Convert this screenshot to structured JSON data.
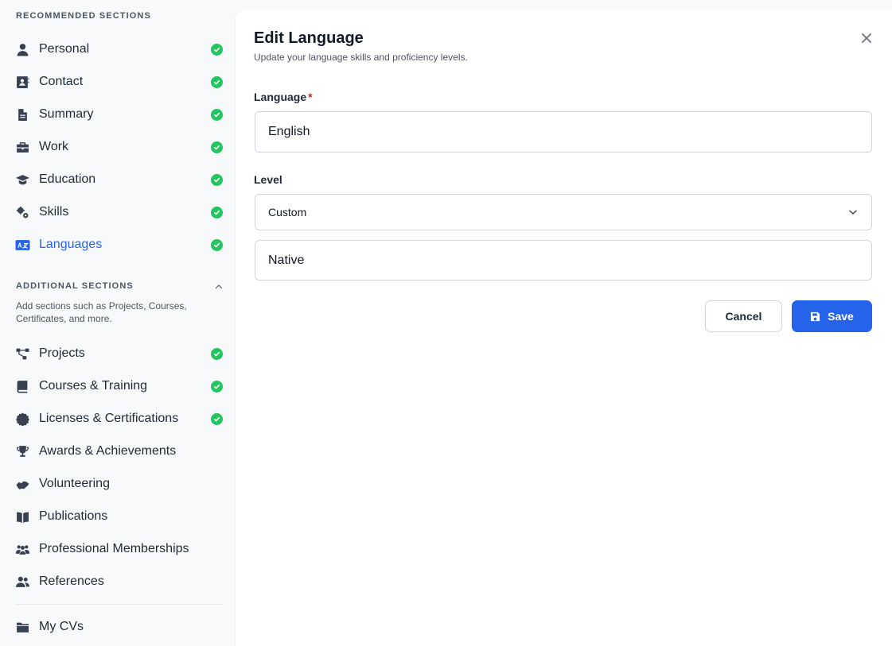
{
  "sidebar": {
    "recommended_heading": "RECOMMENDED SECTIONS",
    "recommended_items": [
      {
        "label": "Personal",
        "icon": "user-icon",
        "completed": true
      },
      {
        "label": "Contact",
        "icon": "contact-card-icon",
        "completed": true
      },
      {
        "label": "Summary",
        "icon": "document-icon",
        "completed": true
      },
      {
        "label": "Work",
        "icon": "briefcase-icon",
        "completed": true
      },
      {
        "label": "Education",
        "icon": "graduation-cap-icon",
        "completed": true
      },
      {
        "label": "Skills",
        "icon": "gears-icon",
        "completed": true
      },
      {
        "label": "Languages",
        "icon": "language-icon",
        "completed": true,
        "active": true
      }
    ],
    "additional_heading": "ADDITIONAL SECTIONS",
    "additional_description": "Add sections such as Projects, Courses, Certificates, and more.",
    "additional_items": [
      {
        "label": "Projects",
        "icon": "diagram-icon",
        "completed": true
      },
      {
        "label": "Courses & Training",
        "icon": "book-icon",
        "completed": true
      },
      {
        "label": "Licenses & Certifications",
        "icon": "certificate-icon",
        "completed": true
      },
      {
        "label": "Awards & Achievements",
        "icon": "trophy-icon",
        "completed": false
      },
      {
        "label": "Volunteering",
        "icon": "handshake-icon",
        "completed": false
      },
      {
        "label": "Publications",
        "icon": "open-book-icon",
        "completed": false
      },
      {
        "label": "Professional Memberships",
        "icon": "people-group-icon",
        "completed": false
      },
      {
        "label": "References",
        "icon": "users-icon",
        "completed": false
      }
    ],
    "footer_item": {
      "label": "My CVs",
      "icon": "folder-icon"
    }
  },
  "panel": {
    "title": "Edit Language",
    "subtitle": "Update your language skills and proficiency levels.",
    "language_label": "Language",
    "required_marker": "*",
    "language_value": "English",
    "level_label": "Level",
    "level_selected": "Custom",
    "custom_level_value": "Native",
    "cancel_label": "Cancel",
    "save_label": "Save"
  },
  "colors": {
    "accent": "#2563eb",
    "success": "#22c55e",
    "required": "#dc2626"
  }
}
